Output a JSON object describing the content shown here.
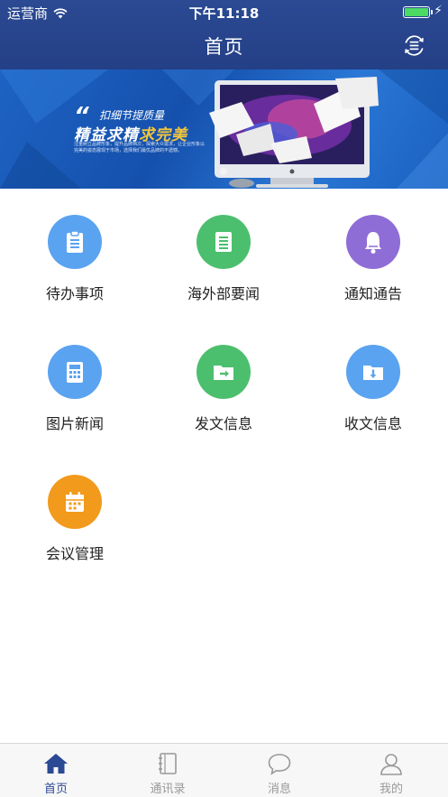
{
  "status_bar": {
    "carrier": "运营商",
    "time": "下午11:18"
  },
  "nav": {
    "title": "首页",
    "right_icon": "refresh-menu-icon"
  },
  "banner": {
    "subtitle": "扣细节提质量",
    "headline_a": "精益求精",
    "headline_b": "求完美",
    "description": "注重树立品牌形象，提升品牌档次，探索大众需求，让企业形象以完美的姿态展现于市场，选择我们最优品牌的不遗憾。"
  },
  "grid": {
    "items": [
      {
        "label": "待办事项",
        "icon": "clipboard-icon",
        "color": "#5aa3f0"
      },
      {
        "label": "海外部要闻",
        "icon": "document-icon",
        "color": "#4cbf6e"
      },
      {
        "label": "通知通告",
        "icon": "bell-icon",
        "color": "#8f6dd6"
      },
      {
        "label": "图片新闻",
        "icon": "calculator-icon",
        "color": "#5aa3f0"
      },
      {
        "label": "发文信息",
        "icon": "folder-send-icon",
        "color": "#4cbf6e"
      },
      {
        "label": "收文信息",
        "icon": "folder-receive-icon",
        "color": "#5aa3f0"
      },
      {
        "label": "会议管理",
        "icon": "calendar-icon",
        "color": "#f29a1c"
      }
    ]
  },
  "tab_bar": {
    "tabs": [
      {
        "label": "首页",
        "icon": "home-icon",
        "active": true
      },
      {
        "label": "通讯录",
        "icon": "contacts-book-icon",
        "active": false
      },
      {
        "label": "消息",
        "icon": "message-bubble-icon",
        "active": false
      },
      {
        "label": "我的",
        "icon": "person-icon",
        "active": false
      }
    ]
  },
  "colors": {
    "nav_bg": "#2b4a93",
    "tab_active": "#2b4a93",
    "tab_inactive": "#999999"
  }
}
